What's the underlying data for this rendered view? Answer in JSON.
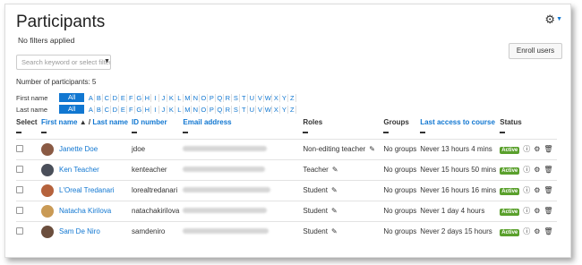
{
  "header": {
    "title": "Participants",
    "filters": "No filters applied",
    "enroll_label": "Enroll users",
    "search_placeholder": "Search keyword or select filter"
  },
  "count_label": "Number of participants: 5",
  "initials": {
    "first_label": "First name",
    "last_label": "Last name",
    "all_label": "All",
    "letters": [
      "A",
      "B",
      "C",
      "D",
      "E",
      "F",
      "G",
      "H",
      "I",
      "J",
      "K",
      "L",
      "M",
      "N",
      "O",
      "P",
      "Q",
      "R",
      "S",
      "T",
      "U",
      "V",
      "W",
      "X",
      "Y",
      "Z"
    ]
  },
  "columns": {
    "select": "Select",
    "first": "First name",
    "sep": "/",
    "last": "Last name",
    "id": "ID number",
    "email": "Email address",
    "roles": "Roles",
    "groups": "Groups",
    "access": "Last access to course",
    "status": "Status"
  },
  "rows": [
    {
      "name": "Janette Doe",
      "id": "jdoe",
      "role": "Non-editing teacher",
      "groups": "No groups",
      "access": "Never  13 hours 4 mins",
      "status": "Active",
      "avatar": "#8a5a44"
    },
    {
      "name": "Ken Teacher",
      "id": "kenteacher",
      "role": "Teacher",
      "groups": "No groups",
      "access": "Never  15 hours 50 mins",
      "status": "Active",
      "avatar": "#4a4f5a"
    },
    {
      "name": "L'Oreal Tredanari",
      "id": "lorealtredanari",
      "role": "Student",
      "groups": "No groups",
      "access": "Never  16 hours 16 mins",
      "status": "Active",
      "avatar": "#b5623c"
    },
    {
      "name": "Natacha Kirilova",
      "id": "natachakirilova",
      "role": "Student",
      "groups": "No groups",
      "access": "Never  1 day 4 hours",
      "status": "Active",
      "avatar": "#c99a55"
    },
    {
      "name": "Sam De Niro",
      "id": "samdeniro",
      "role": "Student",
      "groups": "No groups",
      "access": "Never  2 days 15 hours",
      "status": "Active",
      "avatar": "#6b4e3d"
    }
  ],
  "colors": {
    "link": "#1177d1",
    "active": "#5aa02c"
  }
}
